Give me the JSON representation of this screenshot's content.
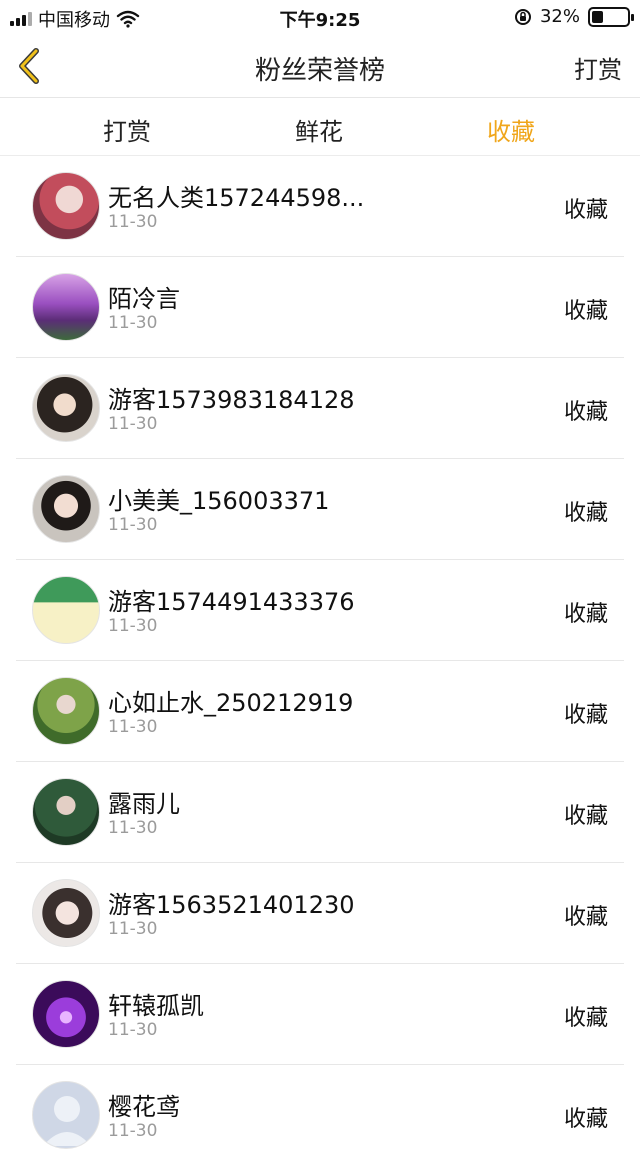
{
  "status": {
    "carrier": "中国移动",
    "time": "下午9:25",
    "battery": "32%",
    "icons": [
      "signal-bars-icon",
      "wifi-icon",
      "rotation-lock-icon",
      "battery-icon"
    ]
  },
  "header": {
    "title": "粉丝荣誉榜",
    "right_label": "打赏",
    "back_icon": "chevron-left-icon",
    "accent": "#F0A61B"
  },
  "tabs": [
    {
      "label": "打赏",
      "active": false
    },
    {
      "label": "鲜花",
      "active": false
    },
    {
      "label": "收藏",
      "active": true
    }
  ],
  "list": [
    {
      "name": "无名人类157244598...",
      "date": "11-30",
      "action": "收藏"
    },
    {
      "name": "陌冷言",
      "date": "11-30",
      "action": "收藏"
    },
    {
      "name": "游客1573983184128",
      "date": "11-30",
      "action": "收藏"
    },
    {
      "name": "小美美_156003371",
      "date": "11-30",
      "action": "收藏"
    },
    {
      "name": "游客1574491433376",
      "date": "11-30",
      "action": "收藏"
    },
    {
      "name": "心如止水_250212919",
      "date": "11-30",
      "action": "收藏"
    },
    {
      "name": "露雨儿",
      "date": "11-30",
      "action": "收藏"
    },
    {
      "name": "游客1563521401230",
      "date": "11-30",
      "action": "收藏"
    },
    {
      "name": "轩辕孤凯",
      "date": "11-30",
      "action": "收藏"
    },
    {
      "name": "樱花鸢",
      "date": "11-30",
      "action": "收藏"
    }
  ]
}
